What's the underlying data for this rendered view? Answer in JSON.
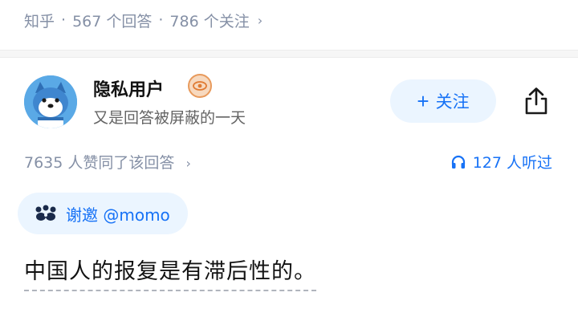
{
  "header": {
    "source": "知乎",
    "answers": "567 个回答",
    "followers": "786 个关注",
    "separator": "·",
    "chevron": "›"
  },
  "author": {
    "name": "隐私用户",
    "bio": "又是回答被屏蔽的一天",
    "badge_icon": "eye-badge-icon",
    "follow_label": "关注",
    "follow_plus": "+",
    "share_icon": "share-icon"
  },
  "stats": {
    "votes": "7635 人赞同了该回答",
    "chevron": "›",
    "listeners": "127 人听过"
  },
  "thanks": {
    "label": "谢邀 @momo"
  },
  "answer": {
    "text": "中国人的报复是有滞后性的。"
  },
  "colors": {
    "accent": "#1772f6",
    "accent_bg": "#ebf5ff",
    "muted": "#8590a6"
  }
}
